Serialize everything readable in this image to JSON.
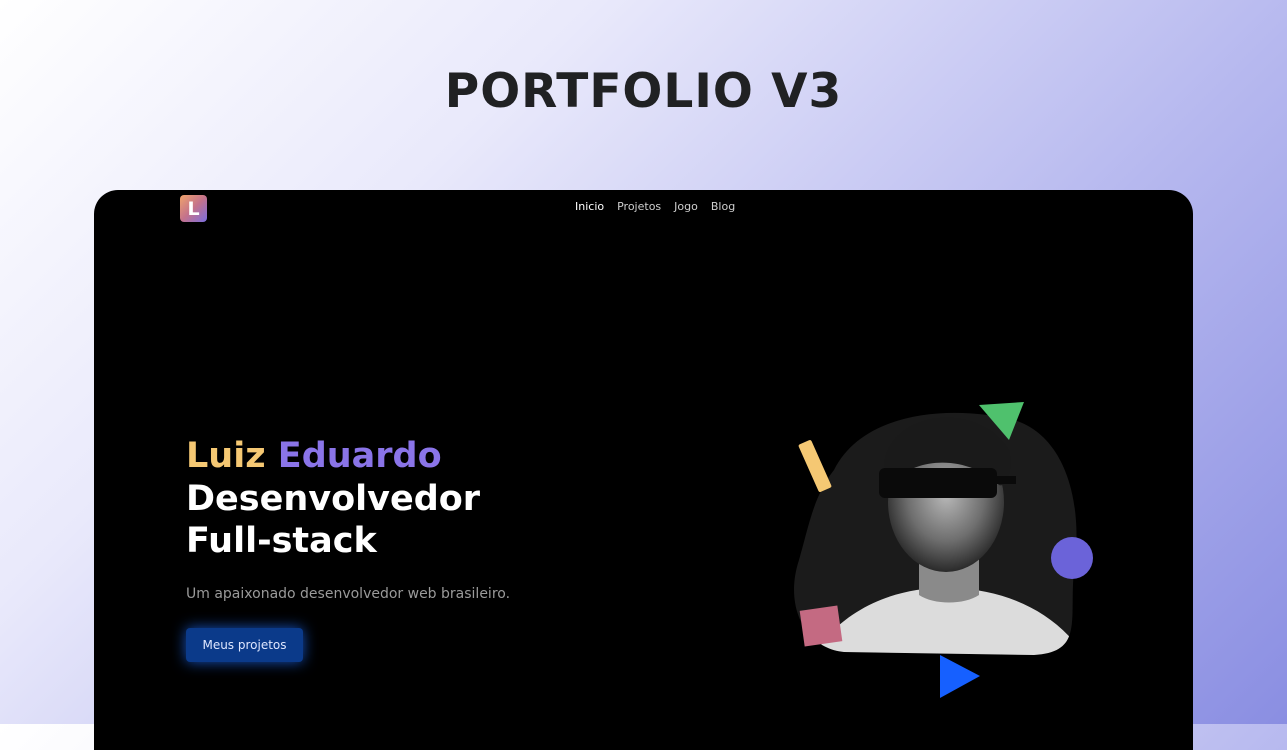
{
  "banner": {
    "title": "PORTFOLIO V3"
  },
  "site": {
    "logo_letter": "L",
    "nav": [
      "Inicio",
      "Projetos",
      "Jogo",
      "Blog"
    ],
    "hero": {
      "first_name": "Luiz",
      "last_name": "Eduardo",
      "role_line1": "Desenvolvedor",
      "role_line2": "Full-stack",
      "subtitle": "Um apaixonado desenvolvedor web brasileiro.",
      "cta_label": "Meus projetos"
    }
  },
  "colors": {
    "accent_yellow": "#f5c873",
    "accent_purple": "#8a74e8",
    "cta_blue": "#0b3a8a",
    "shape_green": "#4fc16d",
    "shape_blue": "#1660ff",
    "shape_pink": "#c46a82",
    "shape_violet": "#6b63d9"
  }
}
